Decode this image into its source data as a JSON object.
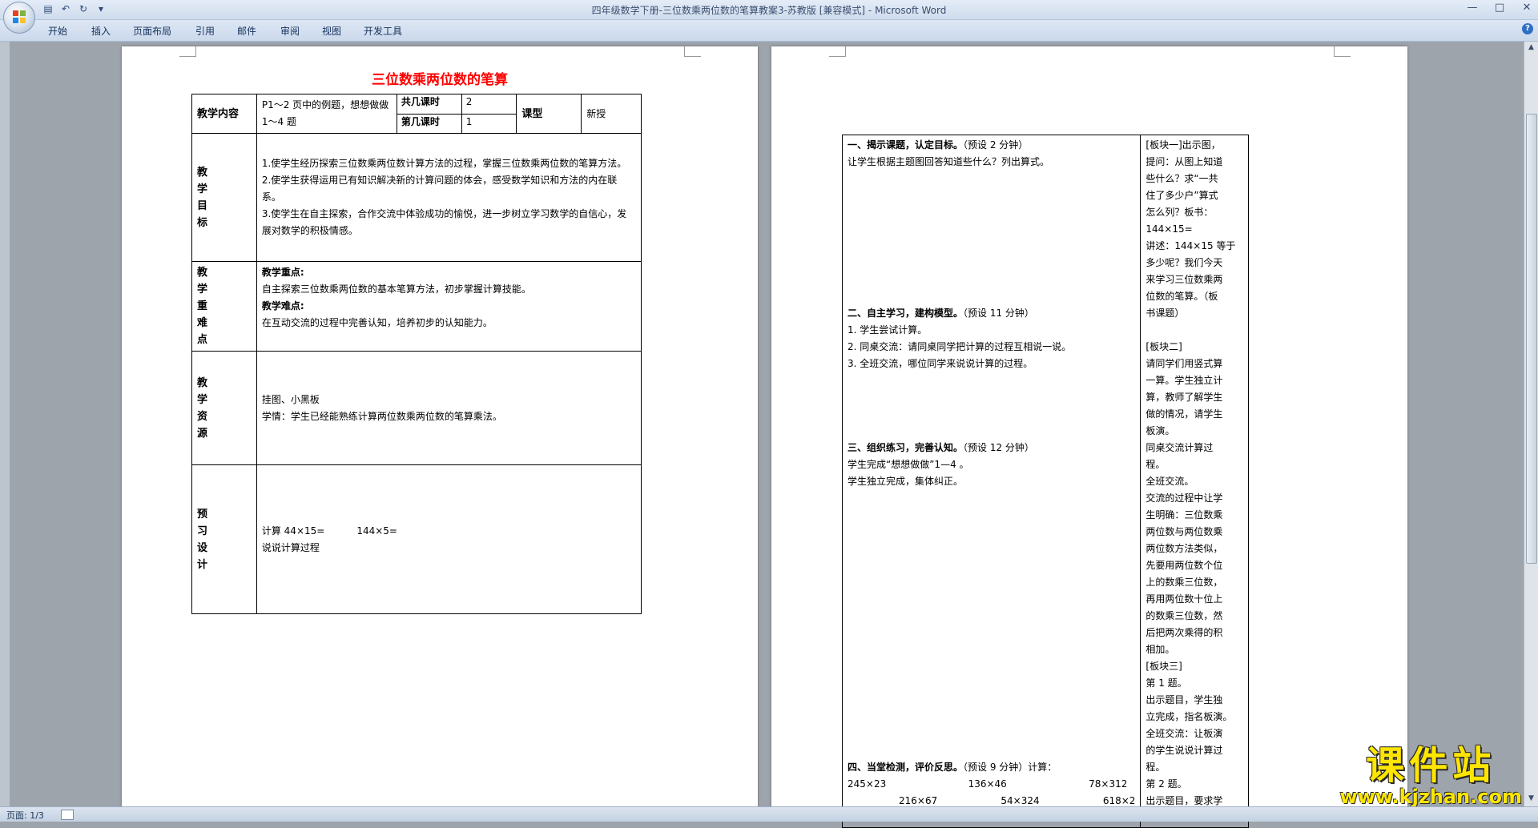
{
  "window": {
    "title": "四年级数学下册-三位数乘两位数的笔算教案3-苏教版 [兼容模式] - Microsoft Word"
  },
  "ribbon": {
    "tabs": [
      {
        "label": "开始"
      },
      {
        "label": "插入"
      },
      {
        "label": "页面布局"
      },
      {
        "label": "引用"
      },
      {
        "label": "邮件"
      },
      {
        "label": "审阅"
      },
      {
        "label": "视图"
      },
      {
        "label": "开发工具"
      }
    ]
  },
  "status": {
    "page_label": "页面: 1/3"
  },
  "page1": {
    "title": "三位数乘两位数的笔算",
    "row1": {
      "label": "教学内容",
      "content": "P1～2 页中的例题，想想做做 1～4 题",
      "total_label": "共几课时",
      "total_value": "2",
      "nth_label": "第几课时",
      "nth_value": "1",
      "type_label": "课型",
      "type_value": "新授"
    },
    "objectives": {
      "label": [
        "教",
        "学",
        "目",
        "标"
      ],
      "items": [
        "1.使学生经历探索三位数乘两位数计算方法的过程，掌握三位数乘两位数的笔算方法。",
        "2.使学生获得运用已有知识解决新的计算问题的体会，感受数学知识和方法的内在联系。",
        "3.使学生在自主探索，合作交流中体验成功的愉悦，进一步树立学习数学的自信心，发展对数学的积极情感。"
      ]
    },
    "keypoints": {
      "label": [
        "教",
        "学",
        "重",
        "难",
        "点"
      ],
      "focus_title": "教学重点:",
      "focus_text": "自主探索三位数乘两位数的基本笔算方法，初步掌握计算技能。",
      "difficulty_title": "教学难点:",
      "difficulty_text": "在互动交流的过程中完善认知，培养初步的认知能力。"
    },
    "resources": {
      "label": [
        "教",
        "学",
        "资",
        "源"
      ],
      "line1": "挂图、小黑板",
      "line2": "学情：学生已经能熟练计算两位数乘两位数的笔算乘法。"
    },
    "preview": {
      "label": [
        "预",
        "习",
        "设",
        "计"
      ],
      "calc1": "计算 44×15=",
      "calc2": "144×5=",
      "line2": "说说计算过程"
    }
  },
  "page2": {
    "left": {
      "s1_title": "一、揭示课题，认定目标。",
      "s1_time": "（预设 2 分钟）",
      "s1_text": "让学生根据主题图回答知道些什么？列出算式。",
      "s2_title": "二、自主学习，建构模型。",
      "s2_time": "（预设 11 分钟）",
      "s2_items": [
        "1. 学生尝试计算。",
        "2. 同桌交流：请同桌同学把计算的过程互相说一说。",
        "3. 全班交流，哪位同学来说说计算的过程。"
      ],
      "s3_title": "三、组织练习，完善认知。",
      "s3_time": "（预设 12 分钟）",
      "s3_items": [
        "学生完成“想想做做”1—4 。",
        "学生独立完成，集体纠正。"
      ],
      "s4_title": "四、当堂检测，评价反思。",
      "s4_time": "（预设 9 分钟）计算：",
      "s4_row1": [
        "245×23",
        "136×46",
        "78×312"
      ],
      "s4_row2": [
        "216×67",
        "54×324",
        "618×2"
      ]
    },
    "right": {
      "lines": [
        "[板块一]出示图，",
        "提问：从图上知道",
        "些什么？求“一共",
        "住了多少户”算式",
        "怎么列？板书：",
        "144×15=",
        "讲述：144×15 等于",
        "多少呢？我们今天",
        "来学习三位数乘两",
        "位数的笔算。（板",
        "书课题）",
        "",
        "[板块二]",
        "请同学们用竖式算",
        "一算。学生独立计",
        "算，教师了解学生",
        "做的情况，请学生",
        "板演。",
        "同桌交流计算过",
        "程。",
        "全班交流。",
        "交流的过程中让学",
        "生明确：三位数乘",
        "两位数与两位数乘",
        "两位数方法类似，",
        "先要用两位数个位",
        "上的数乘三位数，",
        "再用两位数十位上",
        "的数乘三位数，然",
        "后把两次乘得的积",
        "相加。",
        "[板块三]",
        "第 1 题。",
        "出示题目，学生独",
        "立完成，指名板演。",
        "全班交流：让板演",
        "的学生说说计算过",
        "程。",
        "第 2 题。",
        "出示题目，要求学"
      ]
    }
  },
  "watermark": {
    "text": "课件站",
    "url": "www.kjzhan.com"
  }
}
